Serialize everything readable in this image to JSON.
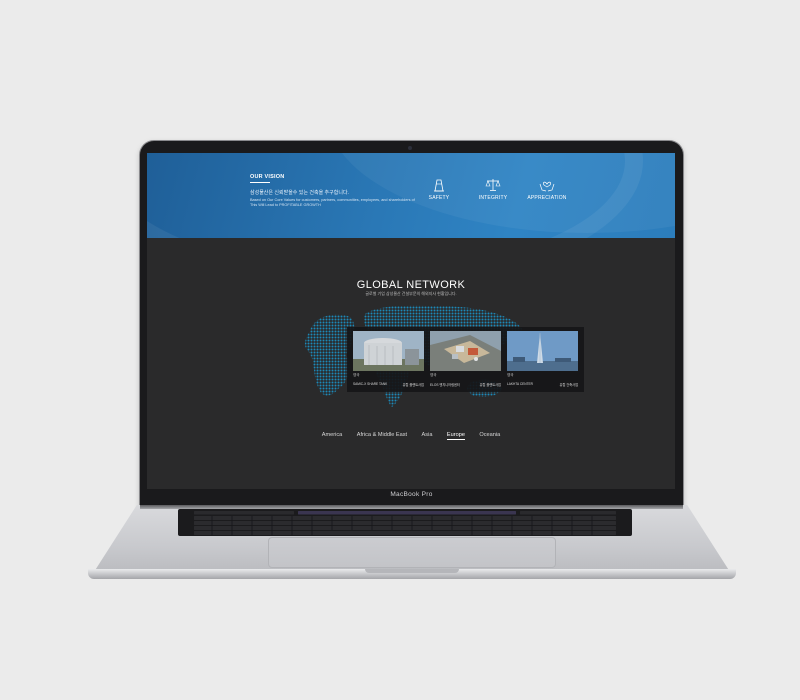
{
  "device": {
    "bezel_label": "MacBook Pro"
  },
  "vision": {
    "eyebrow": "OUR VISION",
    "headline": "삼성물산은 신뢰받을수 있는 건축을 추구합니다.",
    "body": "Based on Our Core Values for customers, partners, communities, employees, and shareholders of This Will Lead to PROFITABLE GROWTH",
    "values": [
      {
        "label": "SAFETY",
        "icon": "tower-icon"
      },
      {
        "label": "INTEGRITY",
        "icon": "scales-icon"
      },
      {
        "label": "APPRECIATION",
        "icon": "hands-heart-icon"
      }
    ]
  },
  "global_network": {
    "title": "GLOBAL NETWORK",
    "subtitle": "글로벌 기업 삼성물산 건설부문의 해외지사 현황입니다.",
    "projects": [
      {
        "country": "영국",
        "name": "SAMIC-X SHARE TANK",
        "category": "유럽 플랜트사업"
      },
      {
        "country": "영국",
        "name": "ELOS 엔지니어링센터",
        "category": "유럽 플랜트사업"
      },
      {
        "country": "영국",
        "name": "LAKHTA CENTER",
        "category": "유럽 건축사업"
      }
    ],
    "regions": [
      {
        "label": "America",
        "active": false
      },
      {
        "label": "Africa & Middle East",
        "active": false
      },
      {
        "label": "Asia",
        "active": false
      },
      {
        "label": "Europe",
        "active": true
      },
      {
        "label": "Oceania",
        "active": false
      }
    ]
  },
  "colors": {
    "vision_band": "#2a78b6",
    "screen_bg": "#2a2a2b",
    "map_dots": "#1c89b8"
  }
}
